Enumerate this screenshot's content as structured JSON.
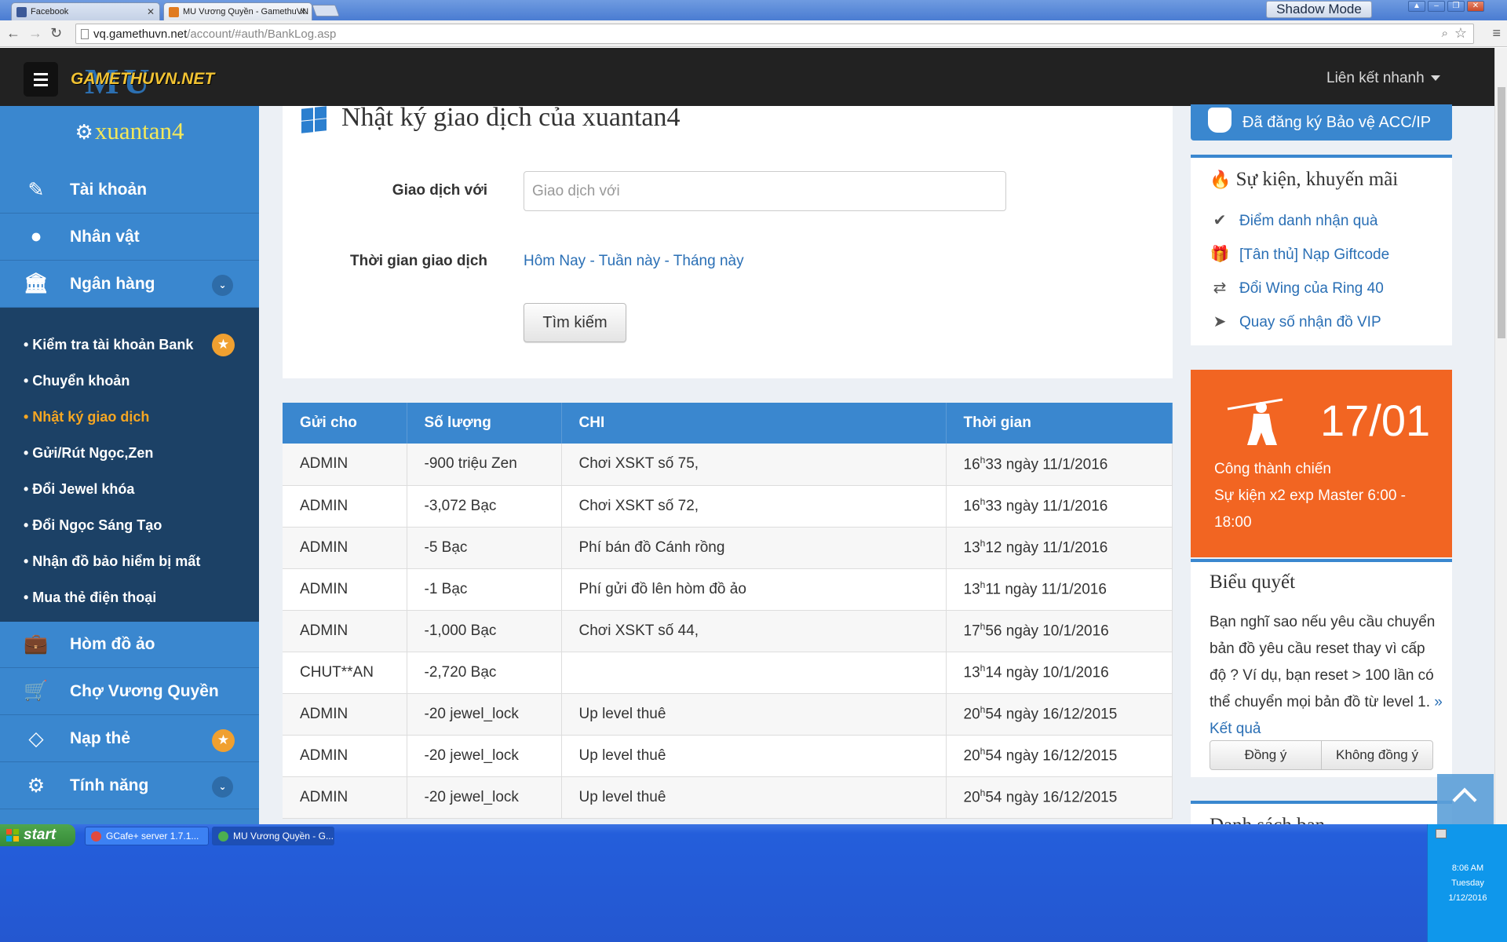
{
  "browser": {
    "tabs": [
      {
        "title": "Facebook",
        "active": false
      },
      {
        "title": "MU Vương Quyền - GamethuVN",
        "active": true
      }
    ],
    "shadow_mode": "Shadow Mode",
    "url_host": "vq.gamethuvn.net",
    "url_path": "/account/#auth/BankLog.asp"
  },
  "header": {
    "logo_text": "GAMETHUVN.NET",
    "logo_mu": "MU",
    "quick_links": "Liên kết nhanh"
  },
  "sidebar": {
    "username": "xuantan4",
    "items": [
      {
        "label": "Tài khoản",
        "icon": "edit-icon"
      },
      {
        "label": "Nhân vật",
        "icon": "user-icon"
      },
      {
        "label": "Ngân hàng",
        "icon": "bank-icon"
      },
      {
        "label": "Hòm đồ ảo",
        "icon": "briefcase-icon"
      },
      {
        "label": "Chợ Vương Quyền",
        "icon": "cart-icon"
      },
      {
        "label": "Nạp thẻ",
        "icon": "diamond-icon"
      },
      {
        "label": "Tính năng",
        "icon": "gears-icon"
      }
    ],
    "submenu": [
      {
        "label": "• Kiểm tra tài khoản Bank"
      },
      {
        "label": "• Chuyển khoản"
      },
      {
        "label": "• Nhật ký giao dịch"
      },
      {
        "label": "• Gửi/Rút Ngọc,Zen"
      },
      {
        "label": "• Đổi Jewel khóa"
      },
      {
        "label": "• Đổi Ngọc Sáng Tạo"
      },
      {
        "label": "• Nhận đồ bảo hiểm bị mất"
      },
      {
        "label": "• Mua thẻ điện thoại"
      }
    ]
  },
  "main": {
    "title": "Nhật ký giao dịch của xuantan4",
    "partner_label": "Giao dịch với",
    "partner_placeholder": "Giao dịch với",
    "time_label": "Thời gian giao dịch",
    "time_today": "Hôm Nay",
    "time_week": "Tuần này",
    "time_month": "Tháng này",
    "search_button": "Tìm kiếm",
    "table": {
      "headers": [
        "Gửi cho",
        "Số lượng",
        "CHI",
        "Thời gian"
      ],
      "rows": [
        {
          "to": "ADMIN",
          "amount": "-900  triệu Zen",
          "chi": "Chơi XSKT số 75,",
          "h": "16",
          "rest": "33 ngày 11/1/2016"
        },
        {
          "to": "ADMIN",
          "amount": "-3,072  Bạc",
          "chi": "Chơi XSKT số 72,",
          "h": "16",
          "rest": "33 ngày 11/1/2016"
        },
        {
          "to": "ADMIN",
          "amount": "-5  Bạc",
          "chi": "Phí bán đồ Cánh rồng",
          "h": "13",
          "rest": "12 ngày 11/1/2016"
        },
        {
          "to": "ADMIN",
          "amount": "-1  Bạc",
          "chi": "Phí gửi đồ lên hòm đồ ảo",
          "h": "13",
          "rest": "11 ngày 11/1/2016"
        },
        {
          "to": "ADMIN",
          "amount": "-1,000  Bạc",
          "chi": "Chơi XSKT số 44,",
          "h": "17",
          "rest": "56 ngày 10/1/2016"
        },
        {
          "to": "CHUT**AN",
          "amount": "-2,720  Bạc",
          "chi": "",
          "h": "13",
          "rest": "14 ngày 10/1/2016"
        },
        {
          "to": "ADMIN",
          "amount": "-20  jewel_lock",
          "chi": "Up level thuê",
          "h": "20",
          "rest": "54 ngày 16/12/2015"
        },
        {
          "to": "ADMIN",
          "amount": "-20  jewel_lock",
          "chi": "Up level thuê",
          "h": "20",
          "rest": "54 ngày 16/12/2015"
        },
        {
          "to": "ADMIN",
          "amount": "-20  jewel_lock",
          "chi": "Up level thuê",
          "h": "20",
          "rest": "54 ngày 16/12/2015"
        }
      ],
      "hour_sup": "h"
    }
  },
  "right": {
    "protect_label": "Đã đăng ký Bảo vệ ACC/IP",
    "events_title": "Sự kiện, khuyến mãi",
    "events": [
      {
        "label": "Điểm danh nhận quà",
        "icon": "check-circle-icon"
      },
      {
        "label": "[Tân thủ] Nạp Giftcode",
        "icon": "gift-icon"
      },
      {
        "label": "Đổi Wing của Ring 40",
        "icon": "exchange-icon"
      },
      {
        "label": "Quay số nhận đồ VIP",
        "icon": "location-arrow-icon"
      }
    ],
    "siege": {
      "date": "17/01",
      "line1": "Công thành chiến",
      "line2": "Sự kiện x2 exp Master 6:00 -",
      "line3": "18:00"
    },
    "poll": {
      "title": "Biểu quyết",
      "text": "Bạn nghĩ sao nếu yêu cầu chuyển bản đồ yêu cầu reset thay vì cấp độ ? Ví dụ, bạn reset > 100 lần có thể chuyển mọi bản đồ từ level 1.",
      "result_link": "» Kết quả",
      "agree": "Đồng ý",
      "disagree": "Không đồng ý"
    },
    "next_title": "Danh sách bạn"
  },
  "taskbar": {
    "start": "start",
    "items": [
      {
        "label": "GCafe+ server 1.7.1..."
      },
      {
        "label": "MU Vương Quyền - G..."
      }
    ],
    "time": "8:06 AM",
    "day": "Tuesday",
    "date": "1/12/2016"
  },
  "colors": {
    "sidebar_blue": "#3a87cf",
    "submenu_navy": "#1c4166",
    "active_orange": "#f5a623",
    "event_orange": "#f26522",
    "link_blue": "#2a6fb5"
  }
}
